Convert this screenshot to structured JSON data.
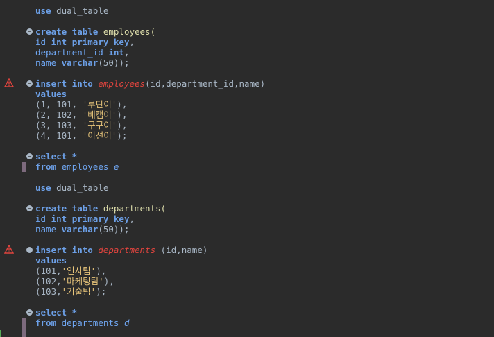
{
  "lines": {
    "l1": "use dual_table",
    "l2_kw": "create table",
    "l2_id": "employees(",
    "l3": "id int primary key,",
    "l4": "department_id int,",
    "l5": "name varchar(50));",
    "l6_kw": "insert into",
    "l6_tbl": "employees",
    "l6_rest": "(id,department_id,name)",
    "l7": "values",
    "l8": "(1, 101, '루탄이'),",
    "l9": "(2, 102, '배캠이'),",
    "l10": "(3, 103, '구구이'),",
    "l11": "(4, 101, '이선이');",
    "l12": "select *",
    "l13_kw": "from",
    "l13_tbl": "employees",
    "l13_alias": "e",
    "l14": "use dual_table",
    "l15_kw": "create table",
    "l15_id": "departments(",
    "l16": "id int primary key,",
    "l17": "name varchar(50));",
    "l18_kw": "insert into",
    "l18_tbl": "departments",
    "l18_rest": " (id,name)",
    "l19": "values",
    "l20": "(101,'인사팀'),",
    "l21": "(102,'마케팅팀'),",
    "l22": "(103,'기술팀');",
    "l23": "select *",
    "l24_kw": "from",
    "l24_tbl": "departments",
    "l24_alias": "d"
  },
  "icons": {
    "fold": "fold-collapse-icon",
    "warning": "warning-icon"
  },
  "colors": {
    "background": "#2b2b2b",
    "keyword": "#6c9fe6",
    "string": "#e7c47a",
    "error_table": "#e0443e",
    "caret_bar": "#7d6a7d"
  }
}
